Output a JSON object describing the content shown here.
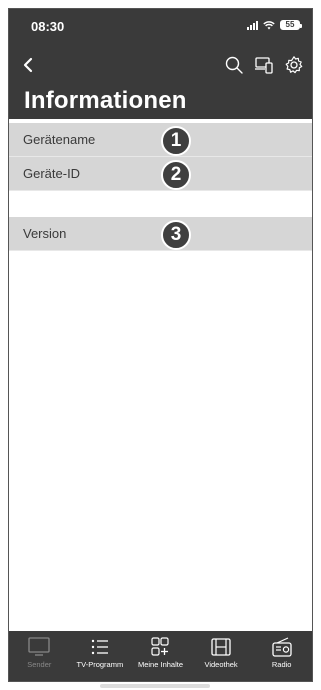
{
  "status_bar": {
    "time": "08:30",
    "battery": "55"
  },
  "header": {
    "title": "Informationen"
  },
  "rows": [
    {
      "label": "Gerätename",
      "callout": "1"
    },
    {
      "label": "Geräte-ID",
      "callout": "2"
    },
    {
      "label": "Version",
      "callout": "3"
    }
  ],
  "tabbar": {
    "items": [
      {
        "label": "Sender",
        "icon": "tv-icon",
        "active": false
      },
      {
        "label": "TV-Programm",
        "icon": "list-icon",
        "active": true
      },
      {
        "label": "Meine Inhalte",
        "icon": "grid-plus-icon",
        "active": true
      },
      {
        "label": "Videothek",
        "icon": "film-icon",
        "active": true
      },
      {
        "label": "Radio",
        "icon": "radio-icon",
        "active": true
      }
    ]
  },
  "colors": {
    "header_bg": "#3a3a3a",
    "row_bg": "#d6d6d6",
    "callout_bg": "#3f3f3f"
  }
}
